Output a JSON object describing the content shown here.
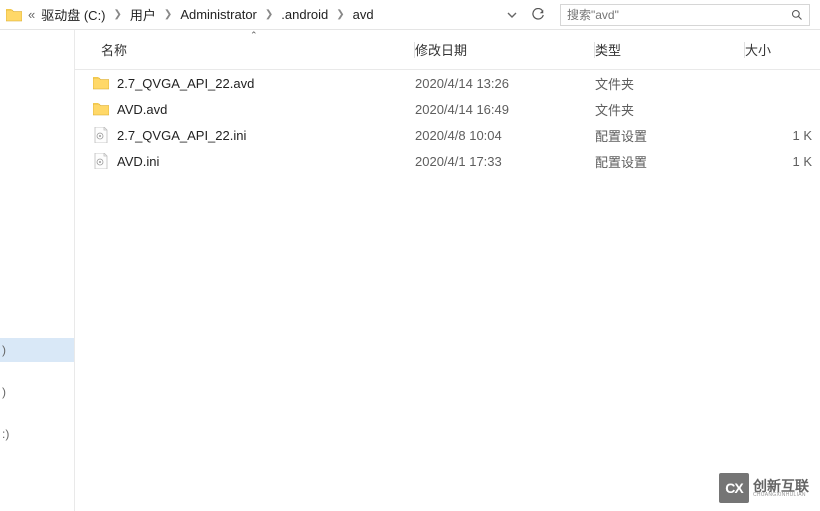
{
  "breadcrumb": {
    "overflow_label": "«",
    "items": [
      "驱动盘 (C:)",
      "用户",
      "Administrator",
      ".android",
      "avd"
    ]
  },
  "search": {
    "placeholder": "搜索\"avd\""
  },
  "columns": {
    "name": "名称",
    "date": "修改日期",
    "type": "类型",
    "size": "大小"
  },
  "left_items": [
    ")",
    ")",
    ":)"
  ],
  "rows": [
    {
      "icon": "folder",
      "name": "2.7_QVGA_API_22.avd",
      "date": "2020/4/14 13:26",
      "type": "文件夹",
      "size": ""
    },
    {
      "icon": "folder",
      "name": "AVD.avd",
      "date": "2020/4/14 16:49",
      "type": "文件夹",
      "size": ""
    },
    {
      "icon": "ini",
      "name": "2.7_QVGA_API_22.ini",
      "date": "2020/4/8 10:04",
      "type": "配置设置",
      "size": "1 K"
    },
    {
      "icon": "ini",
      "name": "AVD.ini",
      "date": "2020/4/1 17:33",
      "type": "配置设置",
      "size": "1 K"
    }
  ],
  "watermark": {
    "logo": "CX",
    "cn": "创新互联",
    "en": "CHUANGXINHULIAN"
  }
}
